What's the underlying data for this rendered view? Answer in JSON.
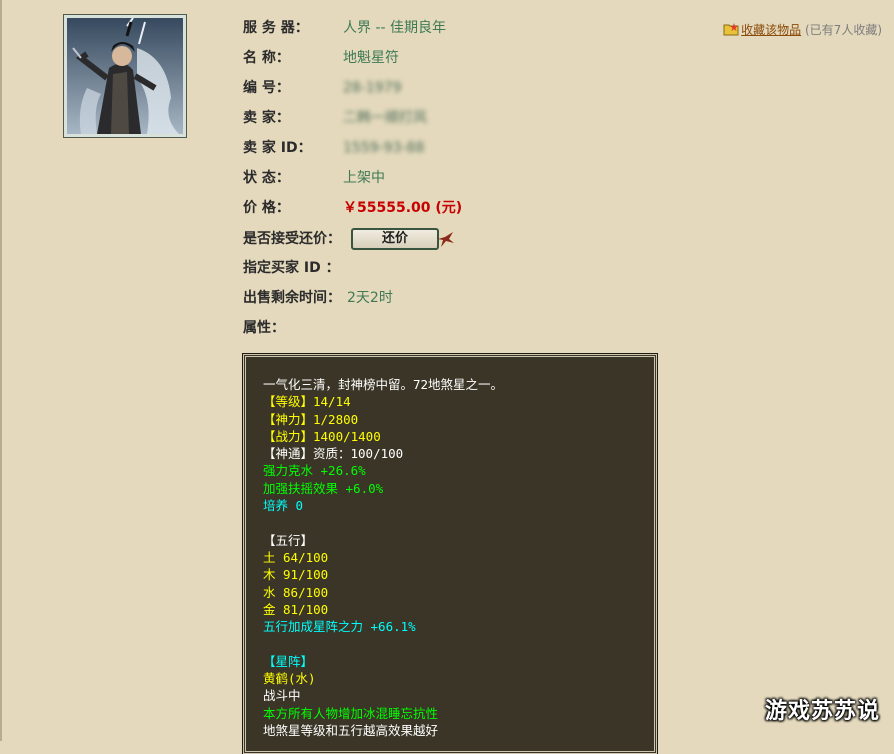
{
  "favorite": {
    "link_label": "收藏该物品",
    "count_text": "(已有7人收藏)"
  },
  "fields": {
    "server_label": "服 务 器：",
    "server_value": "人界 -- 佳期良年",
    "name_label": "名    称：",
    "name_value": "地魁星符",
    "number_label": "编    号：",
    "number_value": "28-1979",
    "seller_label": "卖    家：",
    "seller_value": "二韩一顺打风",
    "seller_id_label": "卖 家  ID：",
    "seller_id_value": "1559-93-88",
    "status_label": "状    态：",
    "status_value": "上架中",
    "price_label": "价    格：",
    "price_value": "￥55555.00 (元)",
    "haggle_label": "是否接受还价：",
    "haggle_button": "还价",
    "buyer_label": "指定买家 ID ：",
    "remaining_label": "出售剩余时间：",
    "remaining_value": "2天2时",
    "attr_label": "属性："
  },
  "panel_lines": [
    {
      "text": "一气化三清，封神榜中留。72地煞星之一。",
      "color": "white"
    },
    {
      "text": "【等级】14/14",
      "color": "yellow"
    },
    {
      "text": "【神力】1/2800",
      "color": "yellow"
    },
    {
      "text": "【战力】1400/1400",
      "color": "yellow"
    },
    {
      "text": "【神通】资质：100/100",
      "color": "white"
    },
    {
      "text": "强力克水 +26.6%",
      "color": "green"
    },
    {
      "text": "加强扶摇效果 +6.0%",
      "color": "green"
    },
    {
      "text": "培养 0",
      "color": "cyan"
    },
    {
      "text": "",
      "color": "white"
    },
    {
      "text": "【五行】",
      "color": "white"
    },
    {
      "text": "土 64/100",
      "color": "yellow"
    },
    {
      "text": "木 91/100",
      "color": "yellow"
    },
    {
      "text": "水 86/100",
      "color": "yellow"
    },
    {
      "text": "金 81/100",
      "color": "yellow"
    },
    {
      "text": "五行加成星阵之力 +66.1%",
      "color": "cyan"
    },
    {
      "text": "",
      "color": "white"
    },
    {
      "text": "【星阵】",
      "color": "cyan"
    },
    {
      "text": "黄鹤(水)",
      "color": "yellow"
    },
    {
      "text": "战斗中",
      "color": "white"
    },
    {
      "text": "本方所有人物增加冰混睡忘抗性",
      "color": "green"
    },
    {
      "text": "地煞星等级和五行越高效果越好",
      "color": "white"
    }
  ],
  "watermark": "游戏苏苏说",
  "colors": {
    "page_bg": "#e4d9bd",
    "panel_bg": "#3a3526",
    "value_green": "#3f7a55",
    "price_red": "#c80000",
    "favorite_link": "#8a4a0a"
  },
  "icons": {
    "favorite": "folder-star-icon",
    "portrait": "character-portrait",
    "haggle_tail": "ribbon-icon"
  }
}
